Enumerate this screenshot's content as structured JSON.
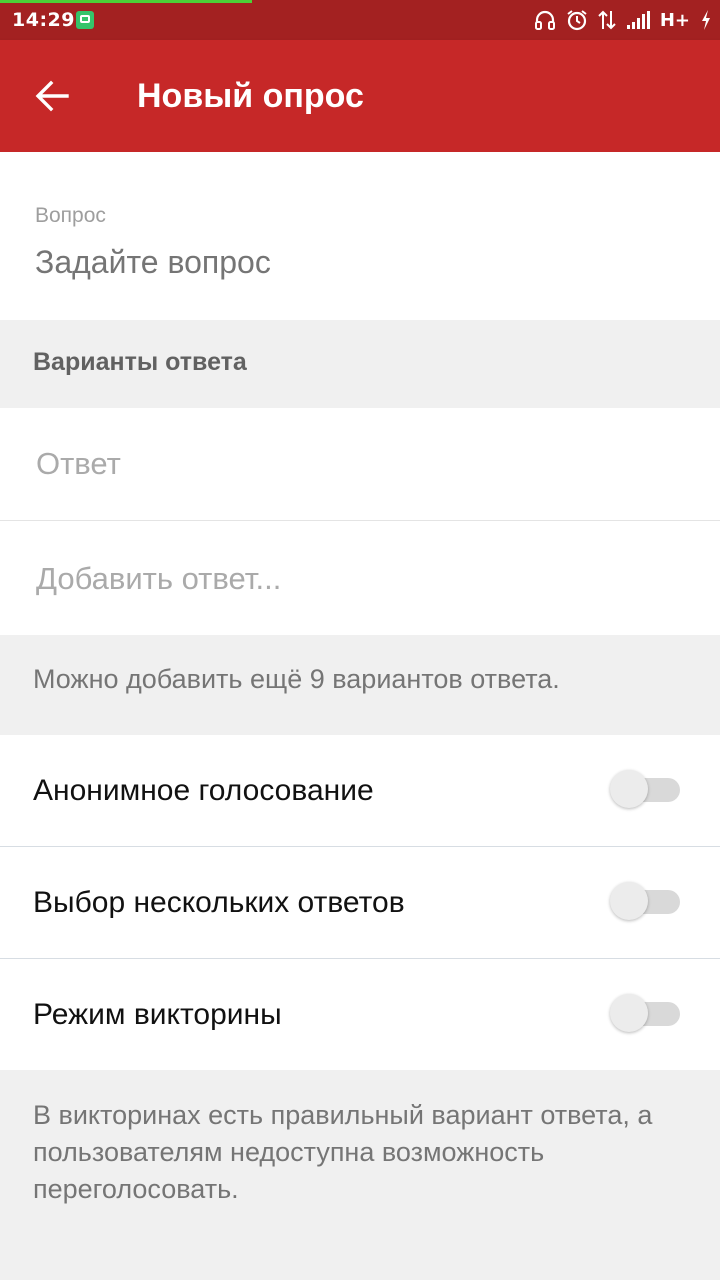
{
  "status_bar": {
    "time": "14:29",
    "network_label": "H+",
    "icons": [
      "app-notification-icon",
      "headset-icon",
      "alarm-icon",
      "data-arrows-icon",
      "signal-icon",
      "charging-icon"
    ],
    "colors": {
      "background": "#a32121",
      "progress": "#4cd137"
    }
  },
  "app_bar": {
    "title": "Новый опрос",
    "back_icon": "arrow-back-icon",
    "color": "#c62828"
  },
  "question": {
    "label": "Вопрос",
    "placeholder": "Задайте вопрос"
  },
  "answers": {
    "header": "Варианты ответа",
    "first_placeholder": "Ответ",
    "add_placeholder": "Добавить ответ...",
    "hint": "Можно добавить ещё 9 вариантов ответа."
  },
  "settings": {
    "anonymous": {
      "label": "Анонимное голосование",
      "enabled": false
    },
    "multiple": {
      "label": "Выбор нескольких ответов",
      "enabled": false
    },
    "quiz": {
      "label": "Режим викторины",
      "enabled": false
    }
  },
  "footer": {
    "note": "В викторинах есть правильный вариант ответа, а пользователям недоступна возможность переголосовать."
  }
}
